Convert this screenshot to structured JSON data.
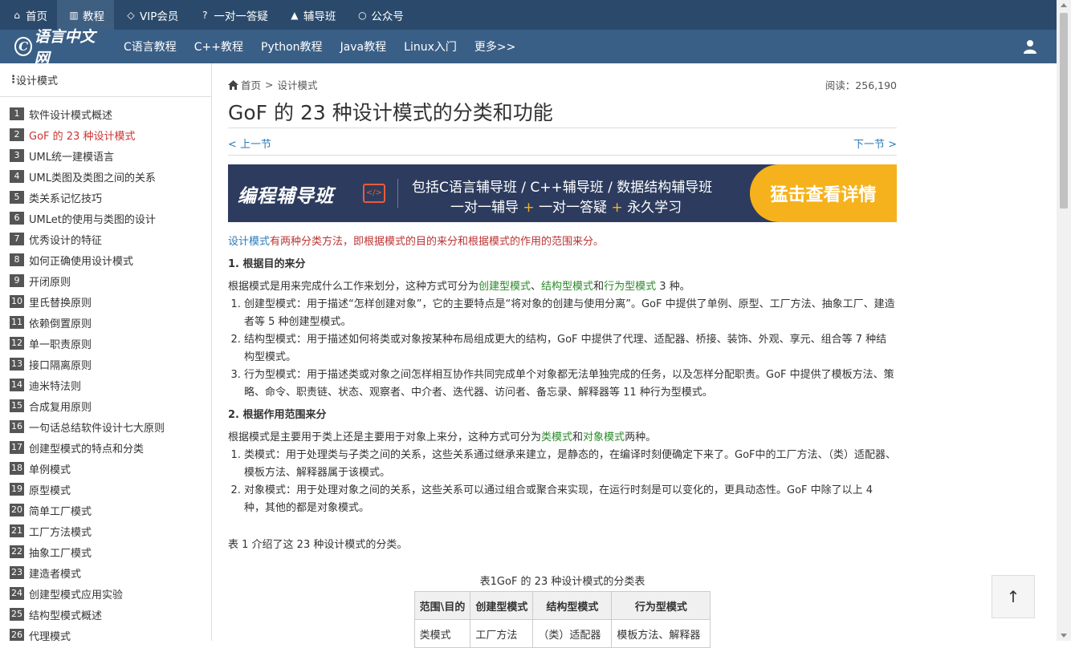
{
  "topnav": {
    "items": [
      {
        "label": "首页",
        "icon": "home-icon"
      },
      {
        "label": "教程",
        "icon": "book-icon"
      },
      {
        "label": "VIP会员",
        "icon": "diamond-icon"
      },
      {
        "label": "一对一答疑",
        "icon": "question-icon"
      },
      {
        "label": "辅导班",
        "icon": "graduation-icon"
      },
      {
        "label": "公众号",
        "icon": "chat-icon"
      }
    ]
  },
  "subnav": {
    "logo": "语言中文网",
    "items": [
      "C语言教程",
      "C++教程",
      "Python教程",
      "Java教程",
      "Linux入门",
      "更多>>"
    ]
  },
  "sidebar": {
    "title": "设计模式",
    "items": [
      {
        "num": "1",
        "label": "软件设计模式概述"
      },
      {
        "num": "2",
        "label": "GoF 的 23 种设计模式"
      },
      {
        "num": "3",
        "label": "UML统一建模语言"
      },
      {
        "num": "4",
        "label": "UML类图及类图之间的关系"
      },
      {
        "num": "5",
        "label": "类关系记忆技巧"
      },
      {
        "num": "6",
        "label": "UMLet的使用与类图的设计"
      },
      {
        "num": "7",
        "label": "优秀设计的特征"
      },
      {
        "num": "8",
        "label": "如何正确使用设计模式"
      },
      {
        "num": "9",
        "label": "开闭原则"
      },
      {
        "num": "10",
        "label": "里氏替换原则"
      },
      {
        "num": "11",
        "label": "依赖倒置原则"
      },
      {
        "num": "12",
        "label": "单一职责原则"
      },
      {
        "num": "13",
        "label": "接口隔离原则"
      },
      {
        "num": "14",
        "label": "迪米特法则"
      },
      {
        "num": "15",
        "label": "合成复用原则"
      },
      {
        "num": "16",
        "label": "一句话总结软件设计七大原则"
      },
      {
        "num": "17",
        "label": "创建型模式的特点和分类"
      },
      {
        "num": "18",
        "label": "单例模式"
      },
      {
        "num": "19",
        "label": "原型模式"
      },
      {
        "num": "20",
        "label": "简单工厂模式"
      },
      {
        "num": "21",
        "label": "工厂方法模式"
      },
      {
        "num": "22",
        "label": "抽象工厂模式"
      },
      {
        "num": "23",
        "label": "建造者模式"
      },
      {
        "num": "24",
        "label": "创建型模式应用实验"
      },
      {
        "num": "25",
        "label": "结构型模式概述"
      },
      {
        "num": "26",
        "label": "代理模式"
      }
    ]
  },
  "breadcrumb": {
    "home": "首页",
    "sep": ">",
    "current": "设计模式"
  },
  "reads": "阅读：256,190",
  "title": "GoF 的 23 种设计模式的分类和功能",
  "pager": {
    "prev": "< 上一节",
    "next": "下一节 >"
  },
  "banner": {
    "brand": "编程辅导班",
    "line1": "包括C语言辅导班 / C++辅导班 / 数据结构辅导班",
    "line2_a": "一对一辅导",
    "line2_b": "一对一答疑",
    "line2_c": "永久学习",
    "plus": "+",
    "cta": "猛击查看详情"
  },
  "article": {
    "intro_link": "设计模式",
    "intro_rest": "有两种分类方法，即根据模式的目的来分和根据模式的作用的范围来分。",
    "h1": "1. 根据目的来分",
    "p1_a": "根据模式是用来完成什么工作来划分，这种方式可分为",
    "p1_b": "创建型模式",
    "p1_c": "、",
    "p1_d": "结构型模式",
    "p1_e": "和",
    "p1_f": "行为型模式",
    "p1_g": " 3 种。",
    "list1": [
      "创建型模式：用于描述“怎样创建对象”，它的主要特点是“将对象的创建与使用分离”。GoF 中提供了单例、原型、工厂方法、抽象工厂、建造者等 5 种创建型模式。",
      "结构型模式：用于描述如何将类或对象按某种布局组成更大的结构，GoF 中提供了代理、适配器、桥接、装饰、外观、享元、组合等 7 种结构型模式。",
      "行为型模式：用于描述类或对象之间怎样相互协作共同完成单个对象都无法单独完成的任务，以及怎样分配职责。GoF 中提供了模板方法、策略、命令、职责链、状态、观察者、中介者、迭代器、访问者、备忘录、解释器等 11 种行为型模式。"
    ],
    "h2": "2. 根据作用范围来分",
    "p2_a": "根据模式是主要用于类上还是主要用于对象上来分，这种方式可分为",
    "p2_b": "类模式",
    "p2_c": "和",
    "p2_d": "对象模式",
    "p2_e": "两种。",
    "list2": [
      "类模式：用于处理类与子类之间的关系，这些关系通过继承来建立，是静态的，在编译时刻便确定下来了。GoF中的工厂方法、（类）适配器、模板方法、解释器属于该模式。",
      "对象模式：用于处理对象之间的关系，这些关系可以通过组合或聚合来实现，在运行时刻是可以变化的，更具动态性。GoF 中除了以上 4 种，其他的都是对象模式。"
    ],
    "table_note": "表 1 介绍了这 23 种设计模式的分类。",
    "caption": "表1GoF 的 23 种设计模式的分类表",
    "table_headers": [
      "范围\\目的",
      "创建型模式",
      "结构型模式",
      "行为型模式"
    ],
    "table_row1": [
      "类模式",
      "工厂方法",
      "（类）适配器",
      "模板方法、解释器"
    ]
  },
  "backtop": "↑",
  "colors": {
    "topbar": "#2b4a6b",
    "subbar": "#3a5f86",
    "link": "#2a7ab8",
    "active": "#cc3333",
    "cta": "#f6b21c"
  }
}
